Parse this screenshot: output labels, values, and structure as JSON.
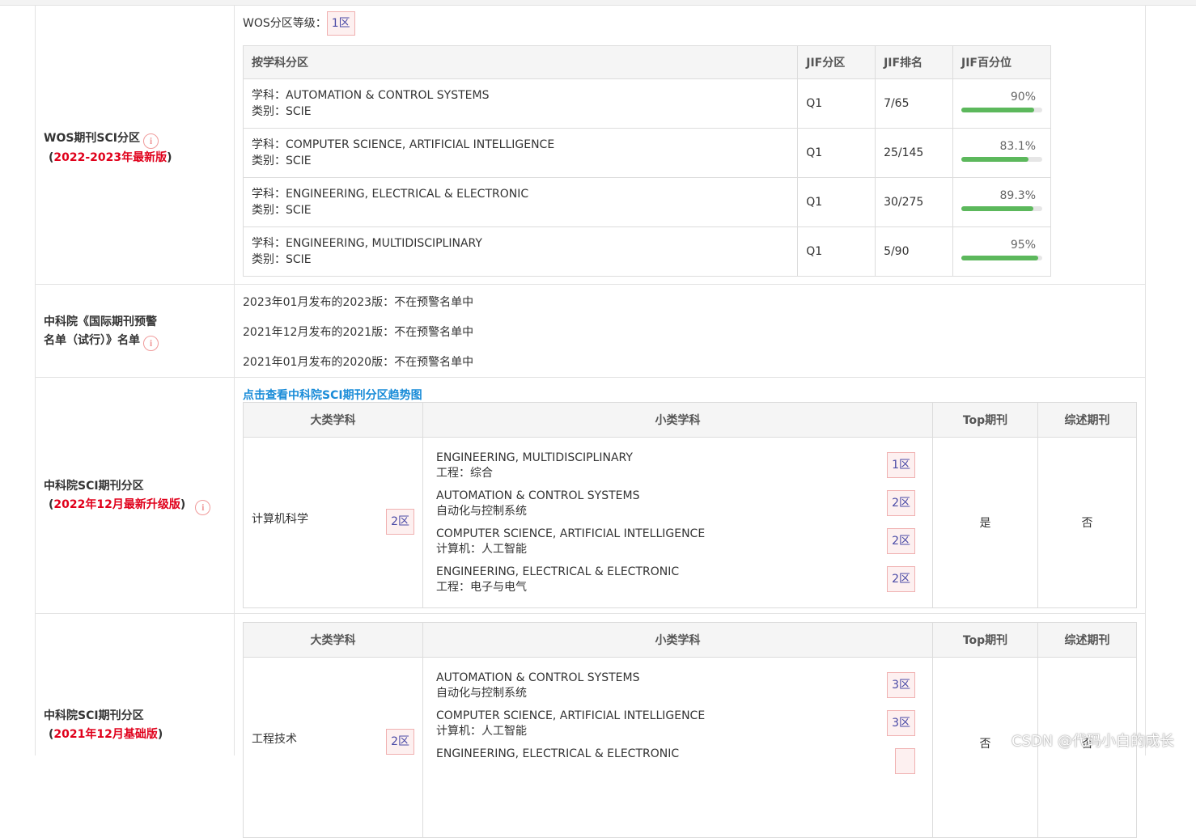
{
  "wos": {
    "label": "WOS期刊SCI分区",
    "edition": "2022-2023年最新版",
    "level_label": "WOS分区等级：",
    "level": "1区",
    "headers": [
      "按学科分区",
      "JIF分区",
      "JIF排名",
      "JIF百分位"
    ],
    "rows": [
      {
        "subject": "学科：AUTOMATION & CONTROL SYSTEMS",
        "category": "类别：SCIE",
        "quartile": "Q1",
        "rank": "7/65",
        "percentile_text": "90%",
        "percentile": 90
      },
      {
        "subject": "学科：COMPUTER SCIENCE, ARTIFICIAL INTELLIGENCE",
        "category": "类别：SCIE",
        "quartile": "Q1",
        "rank": "25/145",
        "percentile_text": "83.1%",
        "percentile": 83.1
      },
      {
        "subject": "学科：ENGINEERING, ELECTRICAL & ELECTRONIC",
        "category": "类别：SCIE",
        "quartile": "Q1",
        "rank": "30/275",
        "percentile_text": "89.3%",
        "percentile": 89.3
      },
      {
        "subject": "学科：ENGINEERING, MULTIDISCIPLINARY",
        "category": "类别：SCIE",
        "quartile": "Q1",
        "rank": "5/90",
        "percentile_text": "95%",
        "percentile": 95
      }
    ]
  },
  "warning": {
    "label_line1": "中科院《国际期刊预警",
    "label_line2": "名单（试行）》名单",
    "lines": [
      "2023年01月发布的2023版：不在预警名单中",
      "2021年12月发布的2021版：不在预警名单中",
      "2021年01月发布的2020版：不在预警名单中"
    ]
  },
  "cas2022": {
    "label": "中科院SCI期刊分区",
    "edition": "2022年12月最新升级版",
    "trend_link": "点击查看中科院SCI期刊分区趋势图",
    "headers": [
      "大类学科",
      "小类学科",
      "Top期刊",
      "综述期刊"
    ],
    "major": "计算机科学",
    "major_zone": "2区",
    "subs": [
      {
        "en": "ENGINEERING, MULTIDISCIPLINARY",
        "cn": "工程：综合",
        "zone": "1区"
      },
      {
        "en": "AUTOMATION & CONTROL SYSTEMS",
        "cn": "自动化与控制系统",
        "zone": "2区"
      },
      {
        "en": "COMPUTER SCIENCE, ARTIFICIAL INTELLIGENCE",
        "cn": "计算机：人工智能",
        "zone": "2区"
      },
      {
        "en": "ENGINEERING, ELECTRICAL & ELECTRONIC",
        "cn": "工程：电子与电气",
        "zone": "2区"
      }
    ],
    "top": "是",
    "review": "否"
  },
  "cas2021": {
    "label": "中科院SCI期刊分区",
    "edition": "2021年12月基础版",
    "headers": [
      "大类学科",
      "小类学科",
      "Top期刊",
      "综述期刊"
    ],
    "major": "工程技术",
    "major_zone": "2区",
    "subs": [
      {
        "en": "AUTOMATION & CONTROL SYSTEMS",
        "cn": "自动化与控制系统",
        "zone": "3区"
      },
      {
        "en": "COMPUTER SCIENCE, ARTIFICIAL INTELLIGENCE",
        "cn": "计算机：人工智能",
        "zone": "3区"
      },
      {
        "en": "ENGINEERING, ELECTRICAL & ELECTRONIC",
        "cn": "",
        "zone": ""
      }
    ],
    "top": "否",
    "review": "否"
  },
  "icons": {
    "info": "info-circle-icon"
  },
  "colors": {
    "edition_red": "#e0001b",
    "link_blue": "#1a8cd8",
    "progress_green": "#5cb85c",
    "zone_border": "#f0b0b0"
  },
  "watermark": "CSDN @代码小白的成长"
}
